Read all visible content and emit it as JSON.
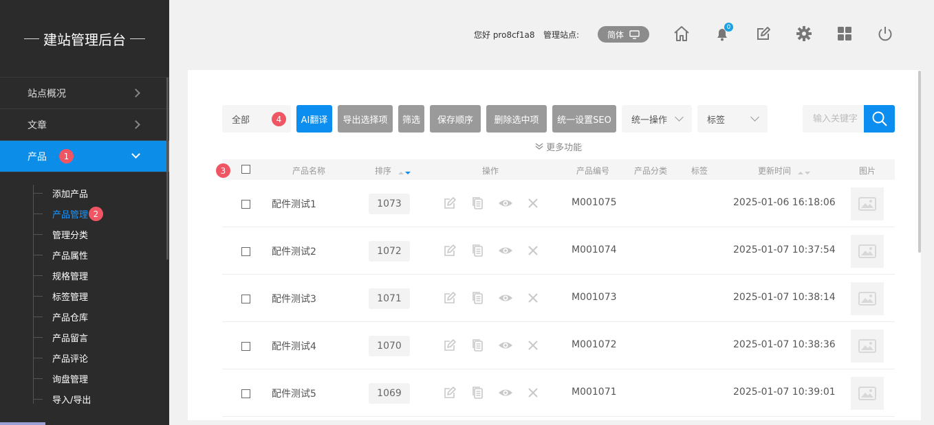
{
  "sidebar": {
    "brand": "建站管理后台",
    "menu": [
      {
        "label": "站点概况"
      },
      {
        "label": "文章"
      },
      {
        "label": "产品",
        "badge": "1"
      }
    ],
    "subitems": [
      "添加产品",
      "产品管理",
      "管理分类",
      "产品属性",
      "规格管理",
      "标签管理",
      "产品仓库",
      "产品留言",
      "产品评论",
      "询盘管理",
      "导入/导出"
    ],
    "active_sub_badge": "2"
  },
  "header": {
    "greeting": "您好 pro8cf1a8",
    "site_label": "管理站点:",
    "lang": "简体",
    "notification_count": "0"
  },
  "toolbar": {
    "filter_all": "全部",
    "badge": "4",
    "ai_translate": "AI翻译",
    "export_selected": "导出选择项",
    "filter": "筛选",
    "save_order": "保存顺序",
    "delete_selected": "删除选中项",
    "seo": "统一设置SEO",
    "batch_ops": "统一操作",
    "tags": "标签",
    "search_placeholder": "输入关键字",
    "more": "更多功能"
  },
  "table": {
    "badge": "3",
    "headers": {
      "name": "产品名称",
      "sort": "排序",
      "ops": "操作",
      "code": "产品编号",
      "category": "产品分类",
      "tags": "标签",
      "updated": "更新时间",
      "image": "图片"
    },
    "rows": [
      {
        "name": "配件测试1",
        "sort": "1073",
        "code": "M001075",
        "updated": "2025-01-06 16:18:06"
      },
      {
        "name": "配件测试2",
        "sort": "1072",
        "code": "M001074",
        "updated": "2025-01-07 10:37:54"
      },
      {
        "name": "配件测试3",
        "sort": "1071",
        "code": "M001073",
        "updated": "2025-01-07 10:38:14"
      },
      {
        "name": "配件测试4",
        "sort": "1070",
        "code": "M001072",
        "updated": "2025-01-07 10:38:36"
      },
      {
        "name": "配件测试5",
        "sort": "1069",
        "code": "M001071",
        "updated": "2025-01-07 10:39:01"
      }
    ]
  },
  "colors": {
    "accent": "#0b8ef0",
    "sidebar_bg": "#2b2b2b",
    "badge": "#f05563",
    "gray_button": "#9a9a9a"
  }
}
